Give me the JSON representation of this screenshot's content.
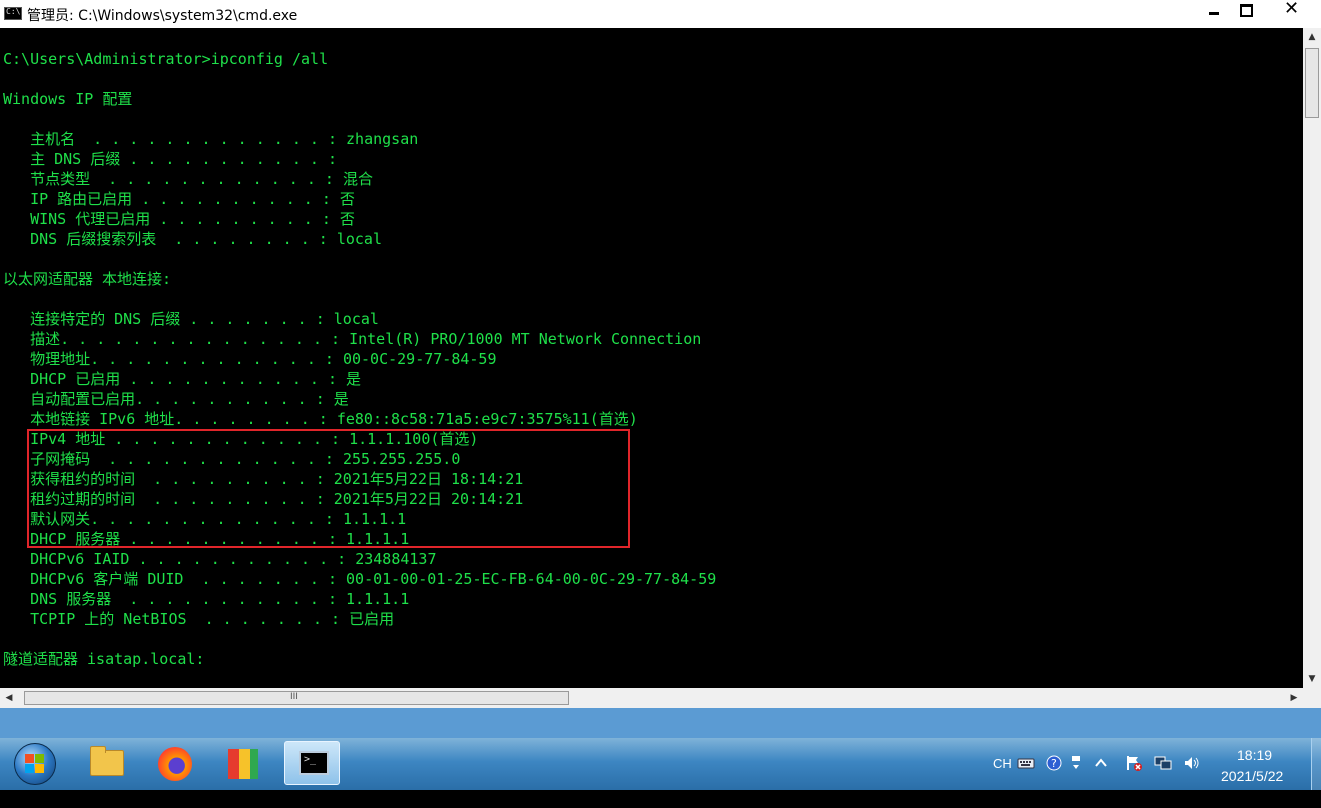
{
  "window": {
    "title": "管理员: C:\\Windows\\system32\\cmd.exe",
    "close_glyph": "✕"
  },
  "console": {
    "lines": [
      "C:\\Users\\Administrator>ipconfig /all",
      "Windows IP 配置",
      "   主机名  . . . . . . . . . . . . . : zhangsan",
      "   主 DNS 后缀 . . . . . . . . . . . :",
      "   节点类型  . . . . . . . . . . . . : 混合",
      "   IP 路由已启用 . . . . . . . . . . : 否",
      "   WINS 代理已启用 . . . . . . . . . : 否",
      "   DNS 后缀搜索列表  . . . . . . . . : local",
      "以太网适配器 本地连接:",
      "   连接特定的 DNS 后缀 . . . . . . . : local",
      "   描述. . . . . . . . . . . . . . . : Intel(R) PRO/1000 MT Network Connection",
      "   物理地址. . . . . . . . . . . . . : 00-0C-29-77-84-59",
      "   DHCP 已启用 . . . . . . . . . . . : 是",
      "   自动配置已启用. . . . . . . . . . : 是",
      "   本地链接 IPv6 地址. . . . . . . . : fe80::8c58:71a5:e9c7:3575%11(首选)",
      "   IPv4 地址 . . . . . . . . . . . . : 1.1.1.100(首选)",
      "   子网掩码  . . . . . . . . . . . . : 255.255.255.0",
      "   获得租约的时间  . . . . . . . . . : 2021年5月22日 18:14:21",
      "   租约过期的时间  . . . . . . . . . : 2021年5月22日 20:14:21",
      "   默认网关. . . . . . . . . . . . . : 1.1.1.1",
      "   DHCP 服务器 . . . . . . . . . . . : 1.1.1.1",
      "   DHCPv6 IAID . . . . . . . . . . . : 234884137",
      "   DHCPv6 客户端 DUID  . . . . . . . : 00-01-00-01-25-EC-FB-64-00-0C-29-77-84-59",
      "   DNS 服务器  . . . . . . . . . . . : 1.1.1.1",
      "   TCPIP 上的 NetBIOS  . . . . . . . : 已启用",
      "隧道适配器 isatap.local:"
    ]
  },
  "colors": {
    "console_text": "#1fe04a",
    "console_bg": "#000000",
    "highlight_border": "#e0252a"
  },
  "scrollbars": {
    "vertical_up": "▲",
    "vertical_down": "▼",
    "horizontal_left": "◀",
    "horizontal_right": "▶",
    "grip": "III"
  },
  "taskbar": {
    "items": [
      "start-icon",
      "folder-icon",
      "firefox-icon",
      "app-icon",
      "cmd-icon"
    ],
    "language": "CH",
    "time": "18:19",
    "date": "2021/5/22"
  }
}
